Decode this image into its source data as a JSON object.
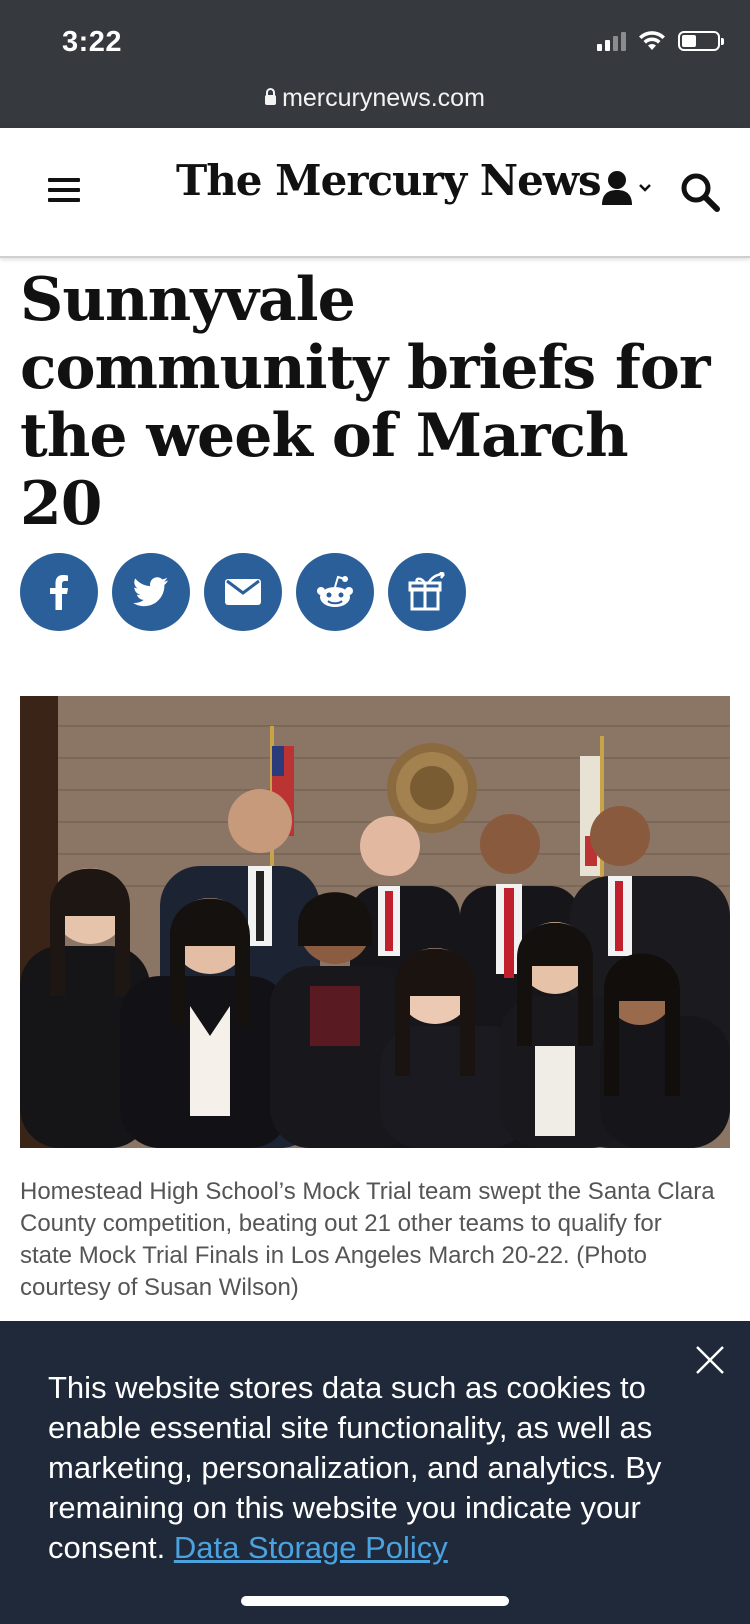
{
  "status_bar": {
    "time": "3:22"
  },
  "browser": {
    "url": "mercurynews.com"
  },
  "header": {
    "logo": "The Mercury News",
    "icons": [
      "menu-icon",
      "user-icon",
      "chevron-down-icon",
      "search-icon"
    ]
  },
  "article": {
    "headline": "Sunnyvale community briefs for the week of March 20",
    "share_buttons": [
      "facebook-icon",
      "twitter-icon",
      "email-icon",
      "reddit-icon",
      "gift-icon"
    ],
    "caption": "Homestead High School’s Mock Trial team swept the Santa Clara County competition, beating out 21 other teams to qualify for state Mock Trial Finals in Los Angeles March 20-22. (Photo courtesy of Susan Wilson)"
  },
  "cookie_banner": {
    "text": "This website stores data such as cookies to enable essential site functionality, as well as marketing, personalization, and analytics. By remaining on this website you indicate your consent.",
    "link_label": "Data Storage Policy"
  },
  "colors": {
    "chrome": "#36393e",
    "share_blue": "#2b5f99",
    "banner": "#202939",
    "link": "#4aa3e0"
  }
}
